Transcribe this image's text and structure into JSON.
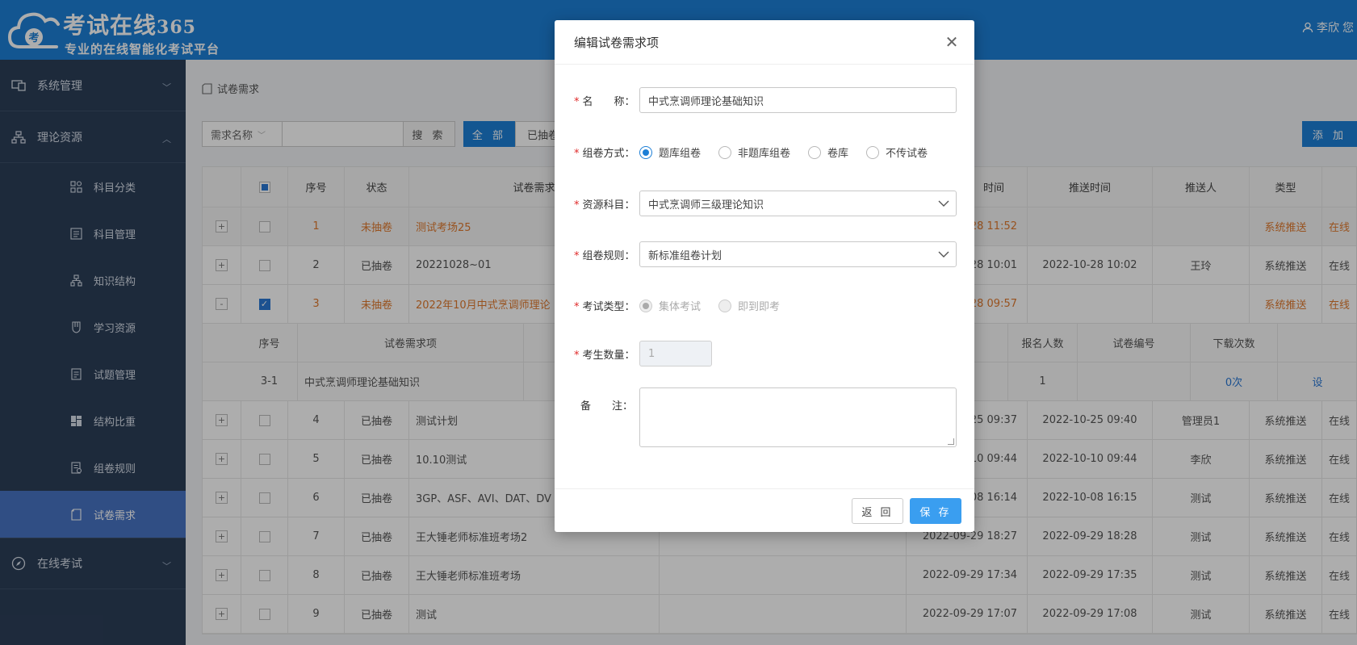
{
  "colors": {
    "brand": "#1d7fd6",
    "sidebar": "#2c3e58",
    "active_menu": "#4773c3",
    "warning_text": "#e07a2e",
    "required": "#e02a2a"
  },
  "header": {
    "logo_title_main": "考试在线",
    "logo_title_num": "365",
    "logo_mark": "考",
    "logo_subtitle": "专业的在线智能化考试平台",
    "user_name": "李欣",
    "user_extra": "您"
  },
  "sidebar": {
    "groups": [
      {
        "label": "系统管理",
        "icon": "monitor-icon",
        "expanded": false
      },
      {
        "label": "理论资源",
        "icon": "sitemap-icon",
        "expanded": true
      },
      {
        "label": "在线考试",
        "icon": "compass-icon",
        "expanded": false
      }
    ],
    "items": [
      {
        "label": "科目分类",
        "icon": "grid-icon"
      },
      {
        "label": "科目管理",
        "icon": "list-icon"
      },
      {
        "label": "知识结构",
        "icon": "structure-icon"
      },
      {
        "label": "学习资源",
        "icon": "shield-icon"
      },
      {
        "label": "试题管理",
        "icon": "document-icon"
      },
      {
        "label": "结构比重",
        "icon": "dashboard-icon"
      },
      {
        "label": "组卷规则",
        "icon": "rules-icon"
      },
      {
        "label": "试卷需求",
        "icon": "paper-icon",
        "active": true
      }
    ]
  },
  "main": {
    "breadcrumb": "试卷需求",
    "filter_select": "需求名称",
    "search_label": "搜 索",
    "tab_all": "全 部",
    "tab_drawn": "已抽卷",
    "add_label": "添 加",
    "table": {
      "headers": {
        "index": "序号",
        "status": "状态",
        "name": "试卷需求",
        "time": "时间",
        "push_time": "推送时间",
        "pusher": "推送人",
        "type": "类型"
      },
      "sub_headers": {
        "index": "序号",
        "item": "试卷需求项",
        "applicants": "报名人数",
        "paper_no": "试卷编号",
        "downloads": "下载次数"
      },
      "rows": [
        {
          "expander": "+",
          "index": "1",
          "status": "未抽卷",
          "name": "测试考场25",
          "time": "28 11:52",
          "push_time": "",
          "pusher": "",
          "type": "系统推送",
          "extra": "在线"
        },
        {
          "expander": "+",
          "index": "2",
          "status": "已抽卷",
          "name": "20221028~01",
          "time": "28 10:01",
          "push_time": "2022-10-28 10:02",
          "pusher": "王玲",
          "type": "系统推送",
          "extra": "在线"
        },
        {
          "expander": "-",
          "index": "3",
          "status": "未抽卷",
          "name": "2022年10月中式烹调师理论",
          "time": "28 09:57",
          "push_time": "",
          "pusher": "",
          "type": "系统推送",
          "extra": "在线"
        },
        {
          "expander": "+",
          "index": "4",
          "status": "已抽卷",
          "name": "测试计划",
          "time": "25 09:37",
          "push_time": "2022-10-25 09:40",
          "pusher": "管理员1",
          "type": "系统推送",
          "extra": "在线"
        },
        {
          "expander": "+",
          "index": "5",
          "status": "已抽卷",
          "name": "10.10测试",
          "time": "10 09:44",
          "push_time": "2022-10-10 09:44",
          "pusher": "李欣",
          "type": "系统推送",
          "extra": "在线"
        },
        {
          "expander": "+",
          "index": "6",
          "status": "已抽卷",
          "name": "3GP、ASF、AVI、DAT、DV",
          "time": "08 16:14",
          "push_time": "2022-10-08 16:15",
          "pusher": "测试",
          "type": "系统推送",
          "extra": "在线"
        },
        {
          "expander": "+",
          "index": "7",
          "status": "已抽卷",
          "name": "王大锤老师标准班考场2",
          "time": "2022-09-29 18:27",
          "push_time": "2022-09-29 18:28",
          "pusher": "测试",
          "type": "系统推送",
          "extra": "在线"
        },
        {
          "expander": "+",
          "index": "8",
          "status": "已抽卷",
          "name": "王大锤老师标准班考场",
          "time": "2022-09-29 17:34",
          "push_time": "2022-09-29 17:35",
          "pusher": "测试",
          "type": "系统推送",
          "extra": "在线"
        },
        {
          "expander": "+",
          "index": "9",
          "status": "已抽卷",
          "name": "测试",
          "time": "2022-09-29 17:07",
          "push_time": "2022-09-29 17:08",
          "pusher": "测试",
          "type": "系统推送",
          "extra": "在线"
        }
      ],
      "sub_row": {
        "index": "3-1",
        "item": "中式烹调师理论基础知识",
        "applicants": "1",
        "paper_no": "",
        "downloads": "0次",
        "extra": "设"
      }
    }
  },
  "modal": {
    "title": "编辑试卷需求项",
    "name_label": "名　　称：",
    "name_value": "中式烹调师理论基础知识",
    "method_label": "组卷方式：",
    "method_options": [
      "题库组卷",
      "非题库组卷",
      "卷库",
      "不传试卷"
    ],
    "method_selected": "题库组卷",
    "subject_label": "资源科目：",
    "subject_value": "中式烹调师三级理论知识",
    "rule_label": "组卷规则：",
    "rule_value": "新标准组卷计划",
    "exam_type_label": "考试类型：",
    "exam_type_options": [
      "集体考试",
      "即到即考"
    ],
    "exam_type_selected": "集体考试",
    "count_label": "考生数量：",
    "count_value": "1",
    "remark_label": "备　　注：",
    "back_label": "返 回",
    "save_label": "保 存"
  }
}
